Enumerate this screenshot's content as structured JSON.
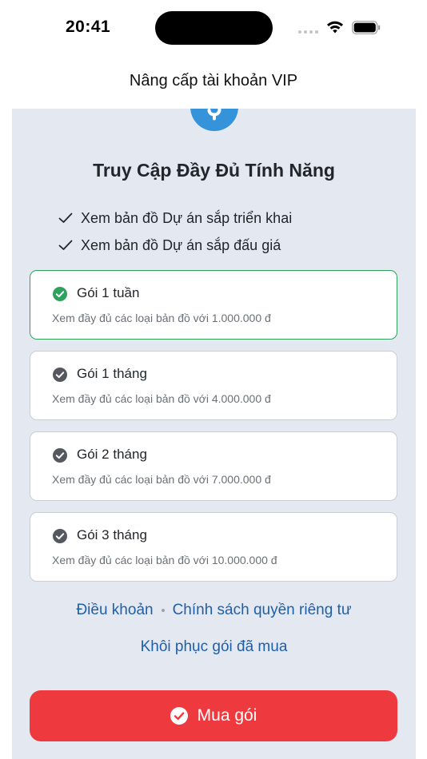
{
  "status_bar": {
    "time": "20:41"
  },
  "nav": {
    "title": "Nâng cấp tài khoản VIP"
  },
  "header": {
    "title": "Truy Cập Đầy Đủ Tính Năng"
  },
  "features": [
    "Xem bản đồ Dự án sắp triển khai",
    "Xem bản đồ Dự án sắp đấu giá"
  ],
  "plans": [
    {
      "name": "Gói 1 tuần",
      "desc": "Xem đầy đủ các loại bản đồ với 1.000.000 đ",
      "selected": true
    },
    {
      "name": "Gói 1 tháng",
      "desc": "Xem đầy đủ các loại bản đồ với 4.000.000 đ",
      "selected": false
    },
    {
      "name": "Gói 2 tháng",
      "desc": "Xem đầy đủ các loại bản đồ với 7.000.000 đ",
      "selected": false
    },
    {
      "name": "Gói 3 tháng",
      "desc": "Xem đầy đủ các loại bản đồ với 10.000.000 đ",
      "selected": false
    }
  ],
  "links": {
    "terms": "Điều khoản",
    "privacy": "Chính sách quyền riêng tư",
    "restore": "Khôi phục gói đã mua"
  },
  "buy_button": {
    "label": "Mua gói"
  },
  "colors": {
    "accent_blue": "#3593da",
    "selected_green": "#2fa15f",
    "unselected_gray": "#55595f",
    "buy_red": "#ee3a3f",
    "link_blue": "#1f5fa8",
    "panel_bg": "#e4e9f1"
  },
  "icons": {
    "plan_check": "check-circle-icon",
    "feature_check": "checkmark-icon",
    "header_icon": "dollar-icon"
  }
}
